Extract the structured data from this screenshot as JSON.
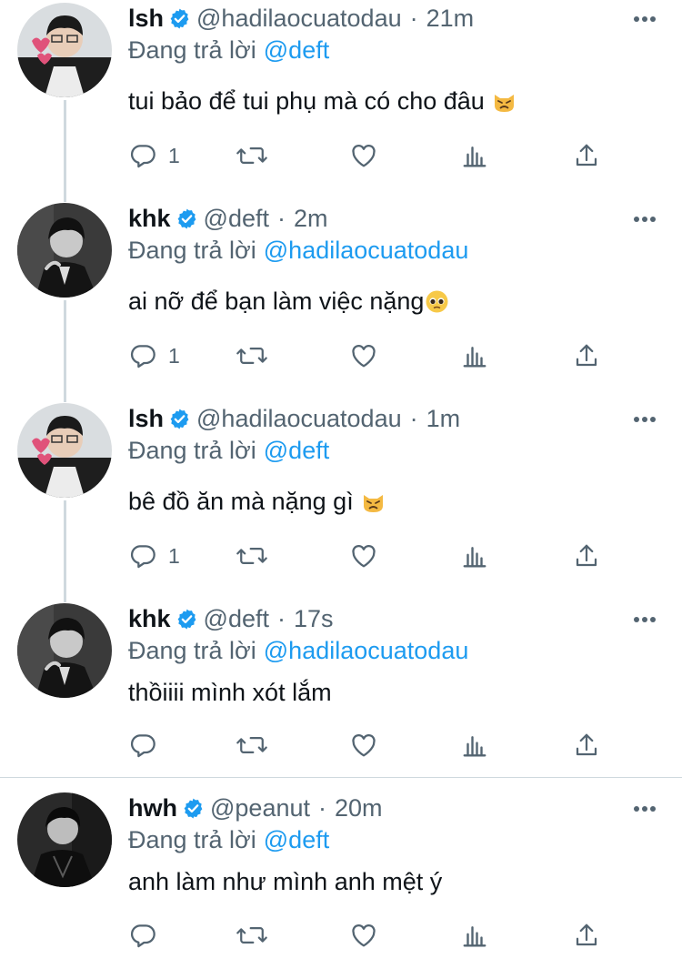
{
  "icons": {
    "verified": "verified-badge-icon",
    "more": "more-dots-icon",
    "reply": "reply-icon",
    "retweet": "retweet-icon",
    "like": "heart-icon",
    "views": "analytics-icon",
    "share": "share-icon"
  },
  "colors": {
    "accent": "#1d9bf0",
    "secondary_text": "#536471",
    "thread_line": "#cfd9de"
  },
  "tweets": [
    {
      "name": "lsh",
      "handle": "@hadilaocuatodau",
      "separator": "·",
      "time": "21m",
      "reply_prefix": "Đang trả lời",
      "reply_to": "@deft",
      "text": "tui bảo để tui phụ mà có cho đâu",
      "emoji": "weary-cat-emoji",
      "reply_count": "1"
    },
    {
      "name": "khk",
      "handle": "@deft",
      "separator": "·",
      "time": "2m",
      "reply_prefix": "Đang trả lời",
      "reply_to": "@hadilaocuatodau",
      "text": "ai nỡ để bạn làm việc nặng",
      "emoji": "pleading-face-emoji",
      "reply_count": "1"
    },
    {
      "name": "lsh",
      "handle": "@hadilaocuatodau",
      "separator": "·",
      "time": "1m",
      "reply_prefix": "Đang trả lời",
      "reply_to": "@deft",
      "text": "bê đồ ăn mà nặng gì",
      "emoji": "weary-cat-emoji",
      "reply_count": "1"
    },
    {
      "name": "khk",
      "handle": "@deft",
      "separator": "·",
      "time": "17s",
      "reply_prefix": "Đang trả lời",
      "reply_to": "@hadilaocuatodau",
      "text": "thồiiii mình xót lắm",
      "emoji": "",
      "reply_count": ""
    },
    {
      "name": "hwh",
      "handle": "@peanut",
      "separator": "·",
      "time": "20m",
      "reply_prefix": "Đang trả lời",
      "reply_to": "@deft",
      "text": "anh làm như mình anh mệt ý",
      "emoji": "",
      "reply_count": ""
    }
  ]
}
